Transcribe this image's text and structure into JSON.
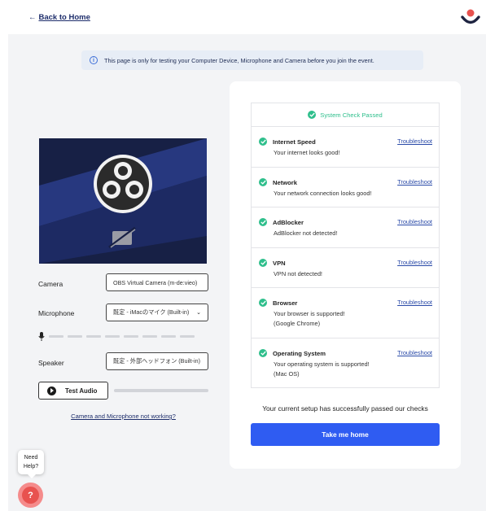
{
  "header": {
    "back_arrow": "←",
    "back_label": "Back to Home"
  },
  "notice": {
    "icon": "i",
    "text": "This page is only for testing your Computer Device, Microphone and Camera before you join the event."
  },
  "devices": {
    "camera_label": "Camera",
    "camera_value": "OBS Virtual Camera (m-de:vieo)",
    "microphone_label": "Microphone",
    "microphone_value": "既定 - iMacのマイク (Built-in)",
    "speaker_label": "Speaker",
    "speaker_value": "既定 - 外部ヘッドフォン (Built-in)",
    "chevron": "⌄",
    "test_audio_label": "Test Audio",
    "not_working_link": "Camera and Microphone not working?"
  },
  "system_check": {
    "header": "System Check Passed",
    "troubleshoot_label": "Troubleshoot",
    "items": [
      {
        "title": "Internet Speed",
        "lines": [
          "Your internet looks good!"
        ]
      },
      {
        "title": "Network",
        "lines": [
          "Your network connection looks good!"
        ]
      },
      {
        "title": "AdBlocker",
        "lines": [
          "AdBlocker not detected!"
        ]
      },
      {
        "title": "VPN",
        "lines": [
          "VPN not detected!"
        ]
      },
      {
        "title": "Browser",
        "lines": [
          "Your browser is supported!",
          "(Google Chrome)"
        ]
      },
      {
        "title": "Operating System",
        "lines": [
          "Your operating system is supported!",
          "(Mac OS)"
        ]
      }
    ],
    "success_text": "Your current setup has successfully passed our checks",
    "home_button": "Take me home"
  },
  "help": {
    "line1": "Need",
    "line2": "Help?",
    "button_glyph": "?"
  },
  "colors": {
    "accent": "#2f5cf2",
    "success": "#2fbf8c",
    "brand": "#e8524f",
    "link": "#1d2d6b"
  }
}
